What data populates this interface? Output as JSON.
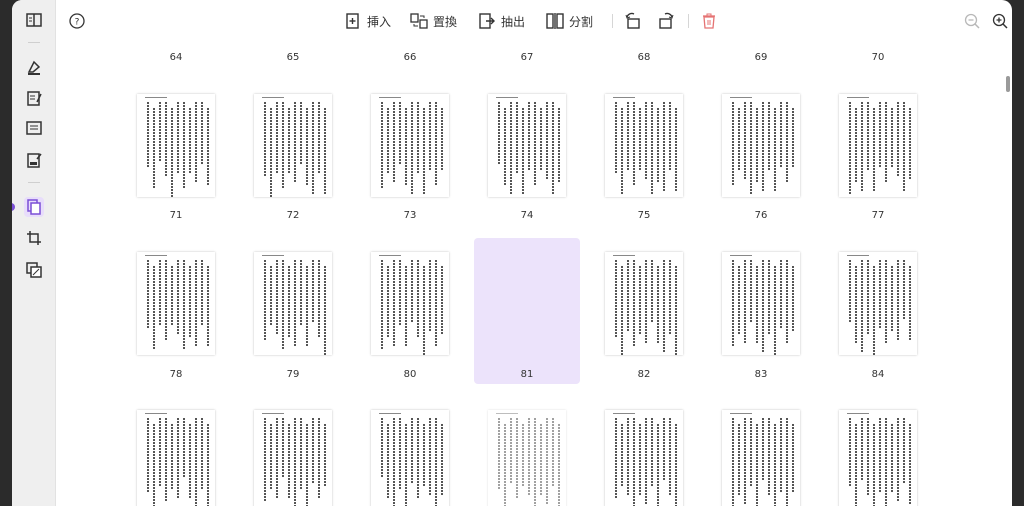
{
  "toolbar": {
    "insert_label": "挿入",
    "replace_label": "置換",
    "extract_label": "抽出",
    "split_label": "分割"
  },
  "rows": [
    {
      "labels": [
        "64",
        "65",
        "66",
        "67",
        "68",
        "69",
        "70"
      ]
    },
    {
      "labels": [
        "71",
        "72",
        "73",
        "74",
        "75",
        "76",
        "77"
      ]
    },
    {
      "labels": [
        "78",
        "79",
        "80",
        "81",
        "82",
        "83",
        "84"
      ]
    }
  ],
  "selected_page": "81",
  "colors": {
    "accent": "#7a4fd6",
    "selection": "#ece3fb",
    "delete": "#e57373"
  }
}
